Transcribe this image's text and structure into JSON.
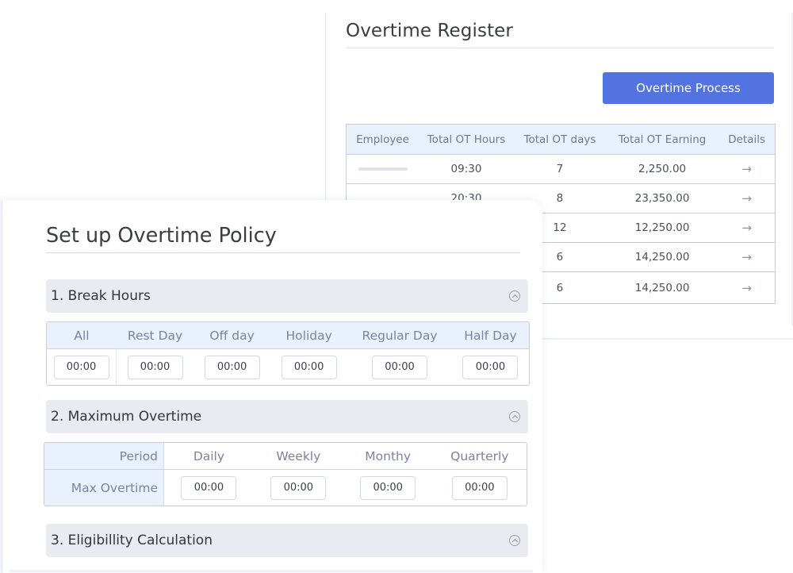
{
  "register": {
    "title": "Overtime Register",
    "process_button": "Overtime Process",
    "columns": [
      "Employee",
      "Total OT Hours",
      "Total OT days",
      "Total OT Earning",
      "Details"
    ],
    "rows": [
      {
        "employee": "",
        "hours": "09:30",
        "days": "7",
        "earning": "2,250.00",
        "details": "→"
      },
      {
        "employee": "",
        "hours": "20:30",
        "days": "8",
        "earning": "23,350.00",
        "details": "→"
      },
      {
        "employee": "",
        "hours": "",
        "days": "12",
        "earning": "12,250.00",
        "details": "→"
      },
      {
        "employee": "",
        "hours": "",
        "days": "6",
        "earning": "14,250.00",
        "details": "→"
      },
      {
        "employee": "",
        "hours": "",
        "days": "6",
        "earning": "14,250.00",
        "details": "→"
      }
    ]
  },
  "policy": {
    "title": "Set up Overtime Policy",
    "sections": [
      {
        "label": "1. Break Hours",
        "icon": "chevron-up-circle-icon"
      },
      {
        "label": "2. Maximum Overtime",
        "icon": "chevron-up-circle-icon"
      },
      {
        "label": "3. Eligibillity Calculation",
        "icon": "chevron-up-circle-icon"
      }
    ],
    "break_hours": {
      "columns": [
        "All",
        "Rest Day",
        "Off day",
        "Holiday",
        "Regular Day",
        "Half Day"
      ],
      "values": [
        "00:00",
        "00:00",
        "00:00",
        "00:00",
        "00:00",
        "00:00"
      ]
    },
    "max_overtime": {
      "period_label": "Period",
      "row_label": "Max Overtime",
      "columns": [
        "Daily",
        "Weekly",
        "Monthy",
        "Quarterly"
      ],
      "values": [
        "00:00",
        "00:00",
        "00:00",
        "00:00"
      ]
    }
  }
}
